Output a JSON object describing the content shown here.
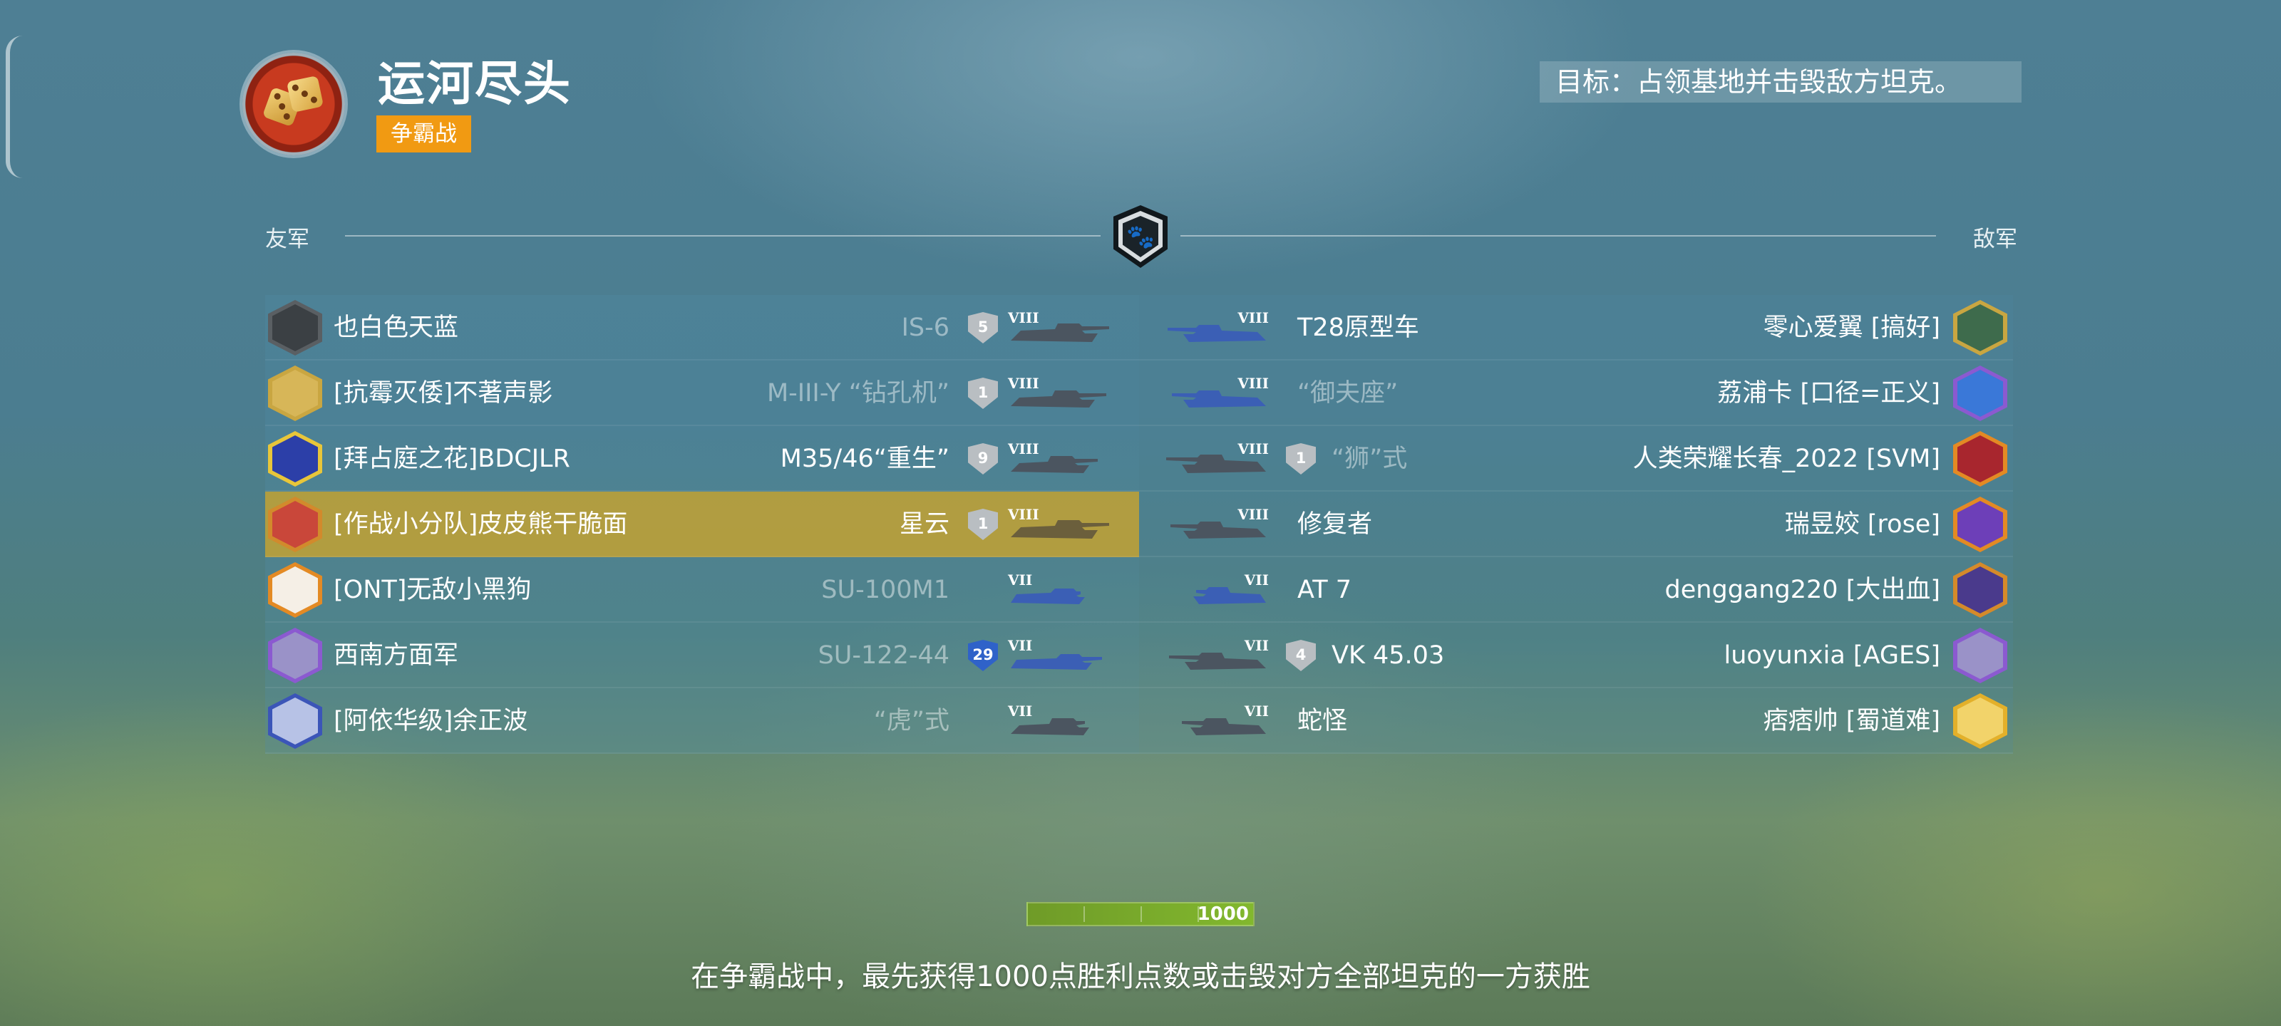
{
  "header": {
    "map_name": "运河尽头",
    "mode_badge": "争霸战",
    "objective": "目标：占领基地并击毁敌方坦克。"
  },
  "teams": {
    "allies_label": "友军",
    "enemies_label": "敌军"
  },
  "allies": [
    {
      "player": "也白色天蓝",
      "tank": "IS-6",
      "tier": "VIII",
      "badge": "5",
      "badge_color": "#b9bec2",
      "self": false
    },
    {
      "player": "[抗霉灭倭]不著声影",
      "tank": "M-III-Y “钻孔机”",
      "tier": "VIII",
      "badge": "1",
      "badge_color": "#b9bec2",
      "self": false
    },
    {
      "player": "[拜占庭之花]BDCJLR",
      "tank": "M35/46“重生”",
      "tier": "VIII",
      "badge": "9",
      "badge_color": "#b9bec2",
      "self": false
    },
    {
      "player": "[作战小分队]皮皮熊干脆面",
      "tank": "星云",
      "tier": "VIII",
      "badge": "1",
      "badge_color": "#b9bec2",
      "self": true
    },
    {
      "player": "[ONT]无敌小黑狗",
      "tank": "SU-100M1",
      "tier": "VII",
      "badge": "",
      "badge_color": "",
      "self": false
    },
    {
      "player": "西南方面军",
      "tank": "SU-122-44",
      "tier": "VII",
      "badge": "29",
      "badge_color": "#2f62c9",
      "self": false
    },
    {
      "player": "[阿依华级]余正波",
      "tank": "“虎”式",
      "tier": "VII",
      "badge": "",
      "badge_color": "",
      "self": false
    }
  ],
  "enemies": [
    {
      "player": "零心爱翼 [搞好]",
      "tank": "T28原型车",
      "tier": "VIII",
      "badge": ""
    },
    {
      "player": "荔浦卡 [口径=正义]",
      "tank": "“御夫座”",
      "tier": "VIII",
      "badge": ""
    },
    {
      "player": "人类荣耀长春_2022 [SVM]",
      "tank": "“狮”式",
      "tier": "VIII",
      "badge": "1"
    },
    {
      "player": "瑞昱姣 [rose]",
      "tank": "修复者",
      "tier": "VIII",
      "badge": ""
    },
    {
      "player": "denggang220 [大出血]",
      "tank": "AT 7",
      "tier": "VII",
      "badge": ""
    },
    {
      "player": "luoyunxia [AGES]",
      "tank": "VK 45.03",
      "tier": "VII",
      "badge": "4"
    },
    {
      "player": "痞痞帅 [蜀道难]",
      "tank": "蛇怪",
      "tier": "VII",
      "badge": ""
    }
  ],
  "score": {
    "target": "1000"
  },
  "rules_text": "在争霸战中，最先获得1000点胜利点数或击毁对方全部坦克的一方获胜",
  "colors": {
    "mode_badge": "#f19a12",
    "self_row": "#cda52d",
    "score_bar": "#82b82e",
    "allied_tank": "#3b5fb5",
    "enemy_tank": "#3a4650"
  },
  "icons": {
    "map": "dice-icon",
    "platoon": "paw-shield-icon"
  }
}
